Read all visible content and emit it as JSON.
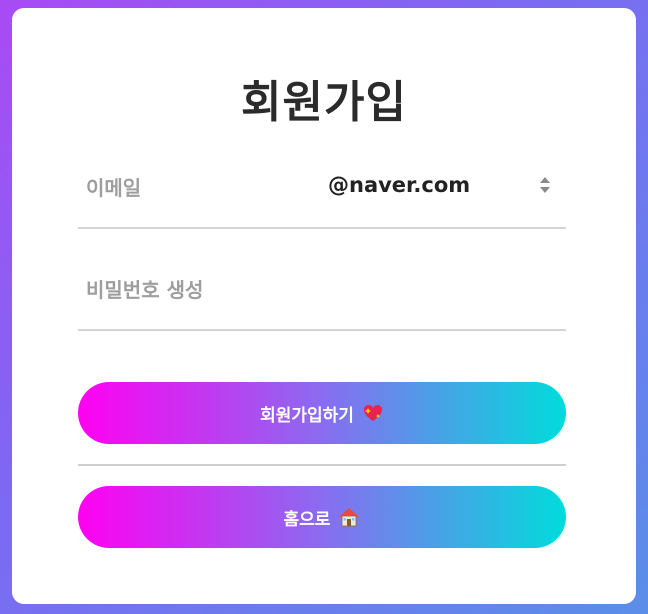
{
  "page": {
    "title": "회원가입"
  },
  "form": {
    "email": {
      "placeholder": "이메일",
      "value": ""
    },
    "domain": {
      "selected": "@naver.com"
    },
    "password": {
      "placeholder": "비밀번호 생성",
      "value": ""
    }
  },
  "buttons": {
    "signup_label": "회원가입하기",
    "signup_icon": "sparkling-heart-icon",
    "home_label": "홈으로",
    "home_icon": "house-icon"
  },
  "colors": {
    "background_start": "#a94af5",
    "background_end": "#5a8ee9",
    "button_gradient_start": "#ff00f2",
    "button_gradient_end": "#00dcdc",
    "title": "#2b2b2b",
    "placeholder": "#9e9e9e"
  }
}
